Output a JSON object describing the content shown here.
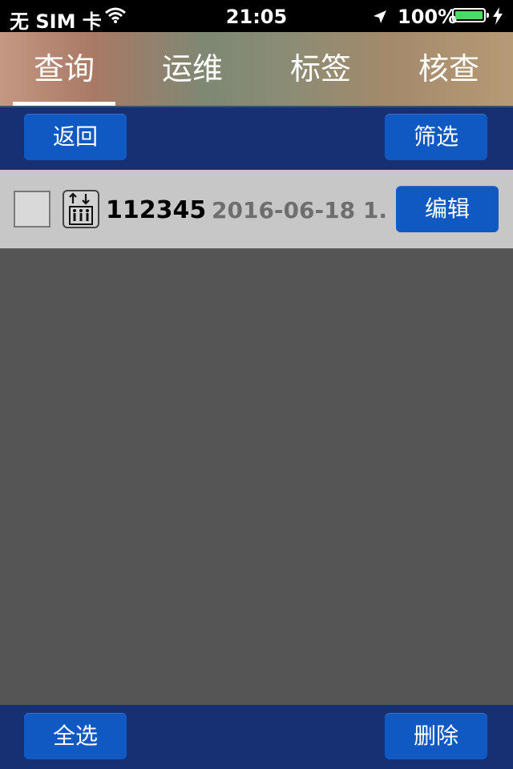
{
  "status_bar": {
    "carrier": "无 SIM 卡",
    "time": "21:05",
    "battery": "100%",
    "battery_color": "#4cd964"
  },
  "tabs": [
    {
      "label": "查询",
      "active": true
    },
    {
      "label": "运维",
      "active": false
    },
    {
      "label": "标签",
      "active": false
    },
    {
      "label": "核查",
      "active": false
    }
  ],
  "top_toolbar": {
    "back_label": "返回",
    "filter_label": "筛选"
  },
  "list": [
    {
      "icon": "elevator-icon",
      "id": "112345",
      "date": "2016-06-18 1...",
      "edit_label": "编辑",
      "checked": false
    }
  ],
  "bottom_toolbar": {
    "select_all_label": "全选",
    "delete_label": "删除"
  },
  "colors": {
    "toolbar_bg": "#173073",
    "button_bg": "#1059c2",
    "content_bg": "#555555",
    "row_bg": "#c7c7c7"
  }
}
